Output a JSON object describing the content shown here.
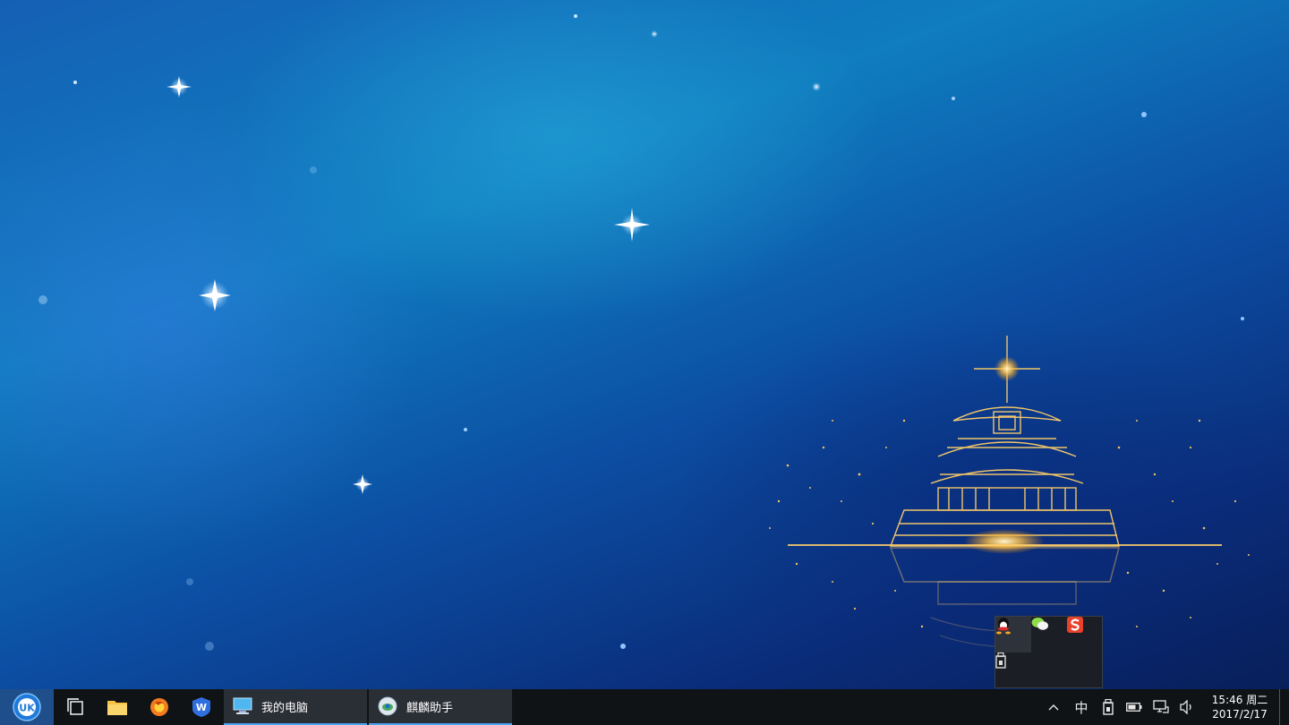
{
  "taskbar": {
    "tasks": [
      {
        "label": "我的电脑"
      },
      {
        "label": "麒麟助手"
      }
    ],
    "tray": {
      "ime": "中",
      "overflow_arrow": "^"
    },
    "clock": {
      "time": "15:46 周二",
      "date": "2017/2/17"
    }
  },
  "tray_popup": {
    "icons": [
      "qq-icon",
      "wechat-icon",
      "sogou-input-icon",
      "usb-drive-icon"
    ]
  },
  "colors": {
    "taskbar_bg": "#101316",
    "task_underline": "#4aa3f0",
    "start_bg": "#1e4f8a"
  }
}
